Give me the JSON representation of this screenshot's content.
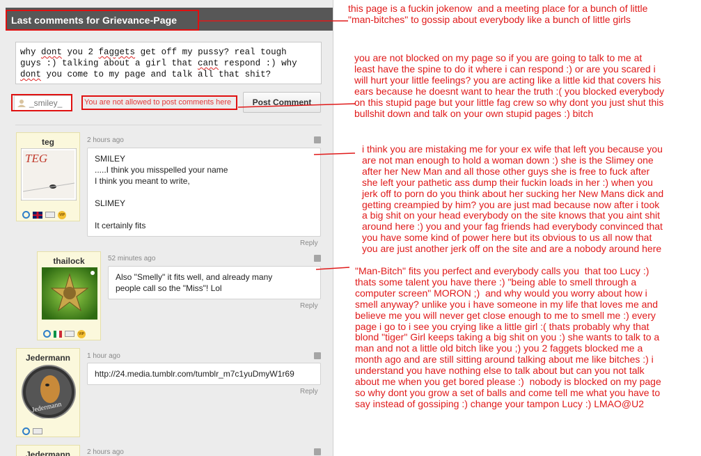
{
  "panel": {
    "title": "Last comments for Grievance-Page",
    "input_text": [
      "why dont you 2 faggets get off my pussy? real tough",
      "guys :) talking about a girl that cant respond :) why",
      "dont you come to my page and talk all that shit?"
    ],
    "username": "_smiley_",
    "not_allowed": "You are not allowed to post comments here",
    "post_button": "Post Comment",
    "reply_label": "Reply"
  },
  "comments": [
    {
      "user": "teg",
      "time": "2 hours ago",
      "lines": [
        "SMILEY",
        ".....I think you misspelled your name",
        "I think you meant to write,",
        "",
        "SLIMEY",
        "",
        "It certainly fits"
      ],
      "avatar_text": "TEG"
    },
    {
      "user": "thailock",
      "time": "52 minutes ago",
      "lines": [
        "Also \"Smelly\" it fits well, and already many",
        "people call so the \"Miss\"! Lol"
      ]
    },
    {
      "user": "Jedermann",
      "time": "1 hour ago",
      "lines": [
        "http://24.media.tumblr.com/tumblr_m7c1yuDmyW1r69"
      ],
      "avatar_text": "Jedermann"
    },
    {
      "user": "Jedermann",
      "time": "2 hours ago"
    }
  ],
  "annotations": {
    "a1": "this page is a fuckin jokenow  and a meeting place for a bunch of little\n\"man-bitches\" to gossip about everybody like a bunch of little girls",
    "a2": "you are not blocked on my page so if you are going to talk to me at\nleast have the spine to do it where i can respond :) or are you scared i\nwill hurt your little feelings? you are acting like a little kid that covers his\nears because he doesnt want to hear the truth :( you blocked everybody\non this stupid page but your little fag crew so why dont you just shut this\nbullshit down and talk on your own stupid pages :) bitch",
    "a3": "i think you are mistaking me for your ex wife that left you because you\nare not man enough to hold a woman down :) she is the Slimey one\nafter her New Man and all those other guys she is free to fuck after\nshe left your pathetic ass dump their fuckin loads in her :) when you\njerk off to porn do you think about her sucking her New Mans dick and\ngetting creampied by him? you are just mad because now after i took\na big shit on your head everybody on the site knows that you aint shit\naround here :) you and your fag friends had everybody convinced that\nyou have some kind of power here but its obvious to us all now that\nyou are just another jerk off on the site and are a nobody around here",
    "a4": "\"Man-Bitch\" fits you perfect and everybody calls you  that too Lucy :)\nthats some talent you have there :) \"being able to smell through a\ncomputer screen\" MORON ;)  and why would you worry about how i\nsmell anyway? unlike you i have someone in my life that loves me and\nbelieve me you will never get close enough to me to smell me :) every\npage i go to i see you crying like a little girl :( thats probably why that\nblond \"tiger\" Girl keeps taking a big shit on you :) she wants to talk to a\nman and not a little old bitch like you ;) you 2 faggets blocked me a\nmonth ago and are still sitting around talking about me like bitches :) i\nunderstand you have nothing else to talk about but can you not talk\nabout me when you get bored please :)  nobody is blocked on my page\nso why dont you grow a set of balls and come tell me what you have to\nsay instead of gossiping :) change your tampon Lucy :) LMAO@U2"
  },
  "colors": {
    "annotation_red": "#e01a1a",
    "header_bg": "#575757",
    "card_bg": "#fbf8dc"
  },
  "icons": [
    "user-icon",
    "male-icon",
    "mail-icon",
    "vip-badge-icon",
    "uk-flag-icon",
    "italy-flag-icon",
    "report-flag-icon"
  ]
}
